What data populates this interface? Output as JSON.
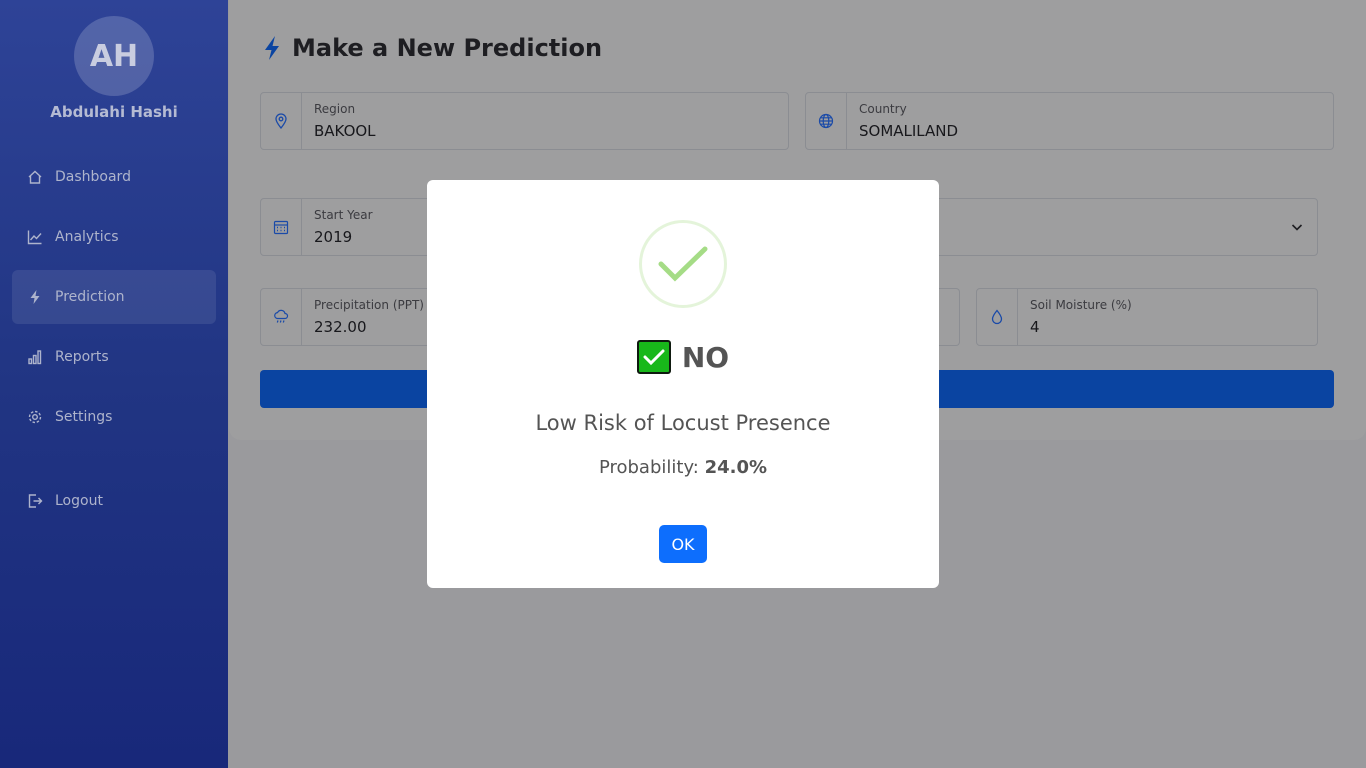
{
  "sidebar": {
    "avatar_initials": "AH",
    "user_name": "Abdulahi Hashi",
    "items": [
      {
        "label": "Dashboard",
        "icon": "home-icon"
      },
      {
        "label": "Analytics",
        "icon": "line-chart-icon"
      },
      {
        "label": "Prediction",
        "icon": "bolt-icon",
        "active": true
      },
      {
        "label": "Reports",
        "icon": "bar-chart-icon"
      },
      {
        "label": "Settings",
        "icon": "gear-icon"
      }
    ],
    "logout_label": "Logout"
  },
  "main": {
    "title": "Make a New Prediction",
    "fields": {
      "region": {
        "label": "Region",
        "value": "BAKOOL",
        "icon": "map-pin-icon"
      },
      "country": {
        "label": "Country",
        "value": "SOMALILAND",
        "icon": "globe-icon"
      },
      "start_year": {
        "label": "Start Year",
        "value": "2019",
        "icon": "calendar-icon"
      },
      "precipitation": {
        "label": "Precipitation (PPT) in",
        "value": "232.00",
        "icon": "rain-cloud-icon"
      },
      "soil_moisture": {
        "label": "Soil Moisture (%)",
        "value": "4",
        "icon": "water-drop-icon"
      }
    }
  },
  "modal": {
    "verdict": "NO",
    "message": "Low Risk of Locust Presence",
    "probability_label": "Probability:",
    "probability_value": "24.0%",
    "ok_label": "OK"
  },
  "colors": {
    "sidebar": "#213583",
    "accent": "#0d6efd",
    "success": "#a5dc86",
    "check": "#18b81a"
  }
}
